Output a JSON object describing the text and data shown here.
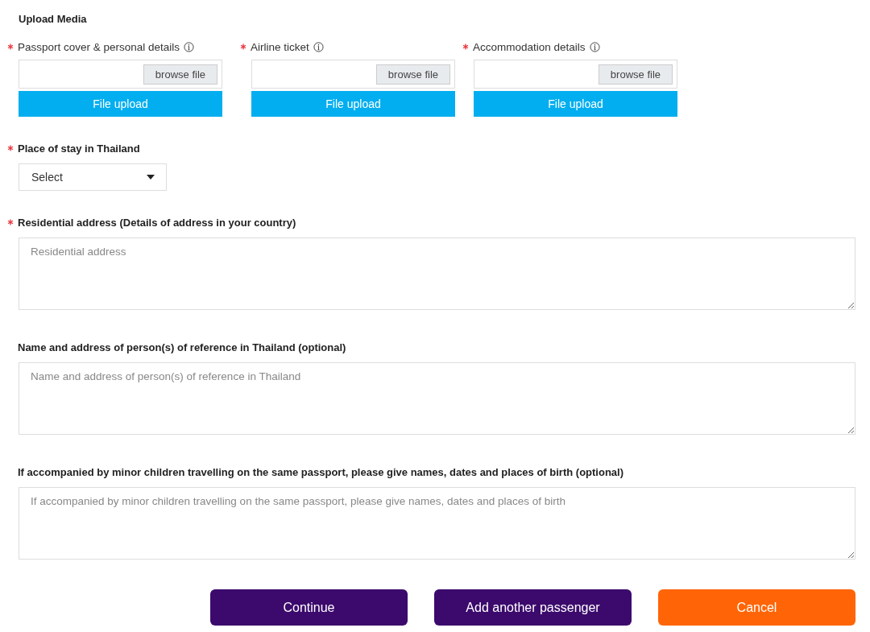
{
  "section_title": "Upload Media",
  "uploads": [
    {
      "label": "Passport cover & personal details",
      "required": true,
      "browse_label": "browse file",
      "upload_label": "File upload"
    },
    {
      "label": "Airline ticket",
      "required": true,
      "browse_label": "browse file",
      "upload_label": "File upload"
    },
    {
      "label": "Accommodation details",
      "required": true,
      "browse_label": "browse file",
      "upload_label": "File upload"
    }
  ],
  "place_of_stay": {
    "label": "Place of stay in Thailand",
    "required": true,
    "value": "Select"
  },
  "text_fields": [
    {
      "label": "Residential address (Details of address in your country)",
      "required": true,
      "placeholder": "Residential address"
    },
    {
      "label": "Name and address of person(s) of reference in Thailand (optional)",
      "required": false,
      "placeholder": "Name and address of person(s) of reference in Thailand"
    },
    {
      "label": "If accompanied by minor children travelling on the same passport, please give names, dates and places of birth (optional)",
      "required": false,
      "placeholder": "If accompanied by minor children travelling on the same passport, please give names, dates and places of birth"
    }
  ],
  "buttons": [
    {
      "label": "Continue",
      "kind": "primary"
    },
    {
      "label": "Add another passenger",
      "kind": "primary"
    },
    {
      "label": "Cancel",
      "kind": "cancel"
    }
  ]
}
